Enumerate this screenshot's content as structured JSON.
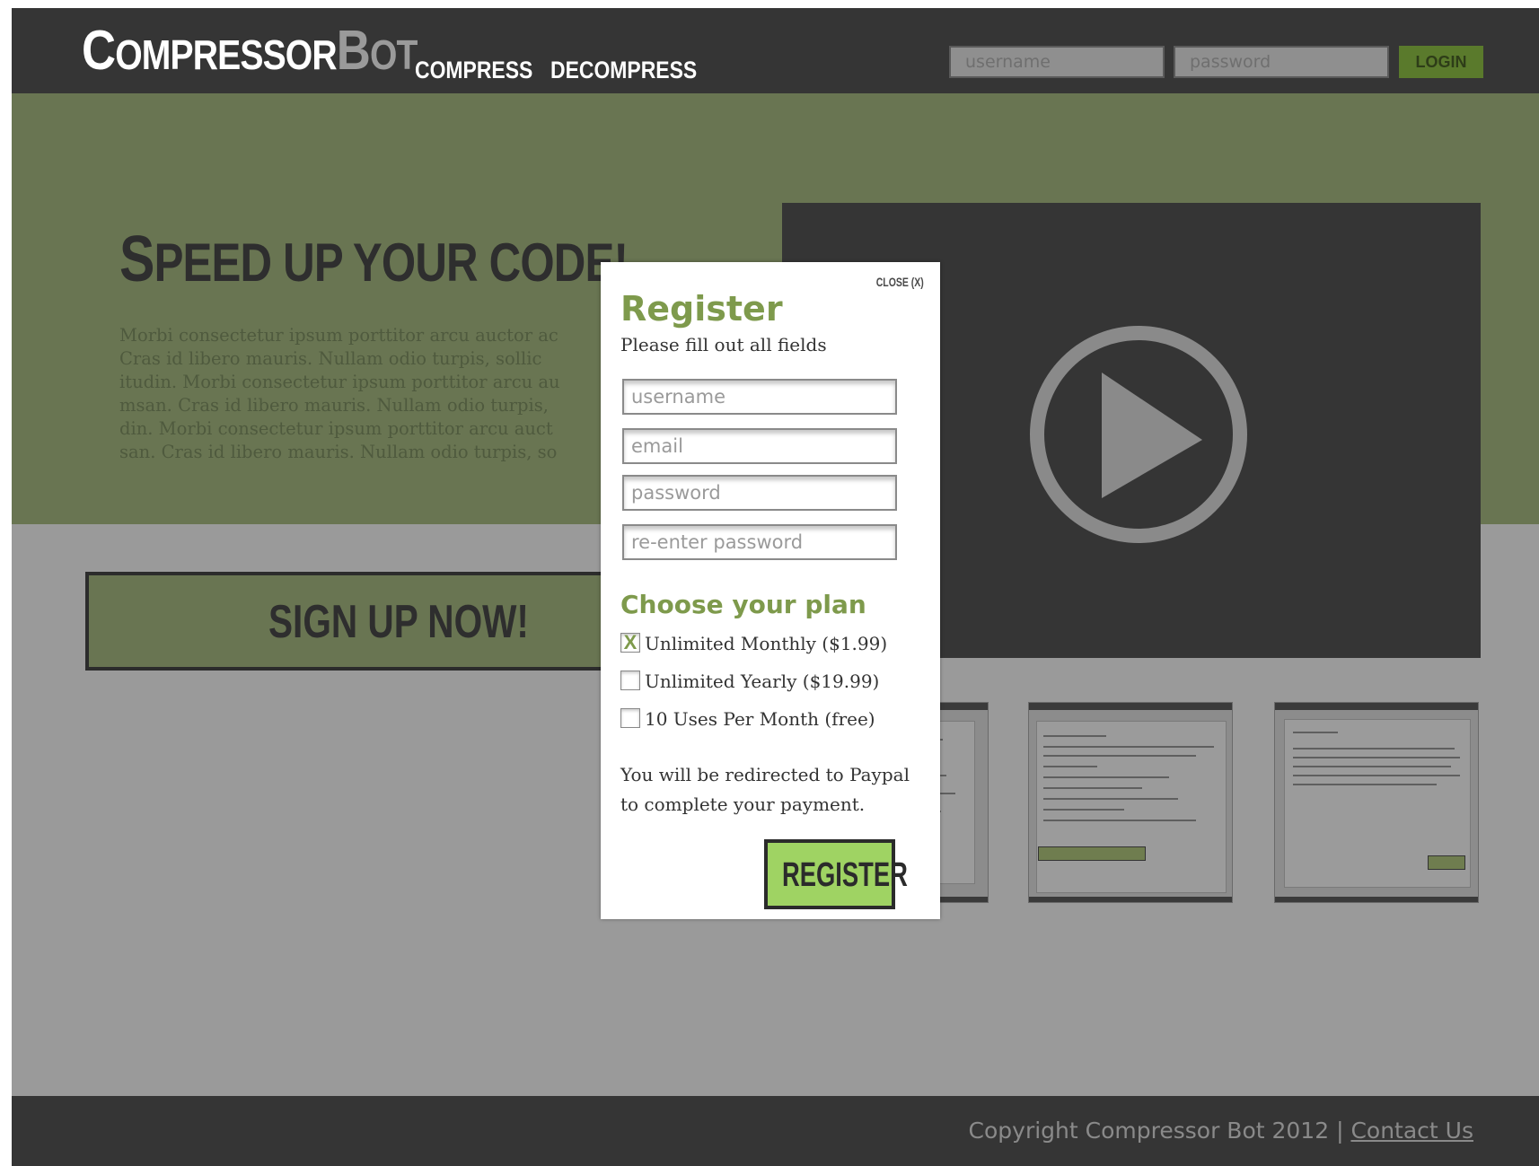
{
  "header": {
    "logo": {
      "part1_cap": "C",
      "part1_rest": "OMPRESSOR",
      "part2_cap": "B",
      "part2_rest": "OT"
    },
    "nav": [
      {
        "label": "COMPRESS"
      },
      {
        "label": "DECOMPRESS"
      }
    ],
    "login": {
      "username_placeholder": "username",
      "password_placeholder": "password",
      "button_label": "LOGIN"
    }
  },
  "hero": {
    "title_cap": "S",
    "title_rest": "PEED UP YOUR CODE!",
    "body": "Morbi consectetur ipsum porttitor arcu auctor ac\nCras id libero mauris. Nullam odio turpis, sollic\nitudin. Morbi consectetur ipsum porttitor arcu au\nmsan. Cras id libero mauris. Nullam odio turpis,\ndin. Morbi consectetur ipsum porttitor arcu auct\nsan. Cras id libero mauris. Nullam odio turpis, so"
  },
  "signup": {
    "label": "SIGN UP NOW!"
  },
  "modal": {
    "close_label": "CLOSE (X)",
    "title": "Register",
    "subtitle": "Please fill out all fields",
    "fields": [
      {
        "placeholder": "username"
      },
      {
        "placeholder": "email"
      },
      {
        "placeholder": "password"
      },
      {
        "placeholder": "re-enter password"
      }
    ],
    "plan_heading": "Choose your plan",
    "plans": [
      {
        "label": "Unlimited Monthly ($1.99)",
        "mark": "X",
        "checked": true
      },
      {
        "label": "Unlimited Yearly ($19.99)",
        "mark": "",
        "checked": false
      },
      {
        "label": "10 Uses Per Month (free)",
        "mark": "",
        "checked": false
      }
    ],
    "note": "You will be redirected to Paypal to complete your payment.",
    "register_label": "REGISTER"
  },
  "footer": {
    "copyright": "Copyright Compressor Bot 2012 |",
    "contact": "Contact Us"
  },
  "colors": {
    "header_bg": "#353535",
    "hero_bg": "#697552",
    "accent_green": "#7e9a4c",
    "button_green": "#9fd363",
    "overlay_gray": "#9a9a9a"
  },
  "icons": {
    "play": "play-circle-icon"
  }
}
